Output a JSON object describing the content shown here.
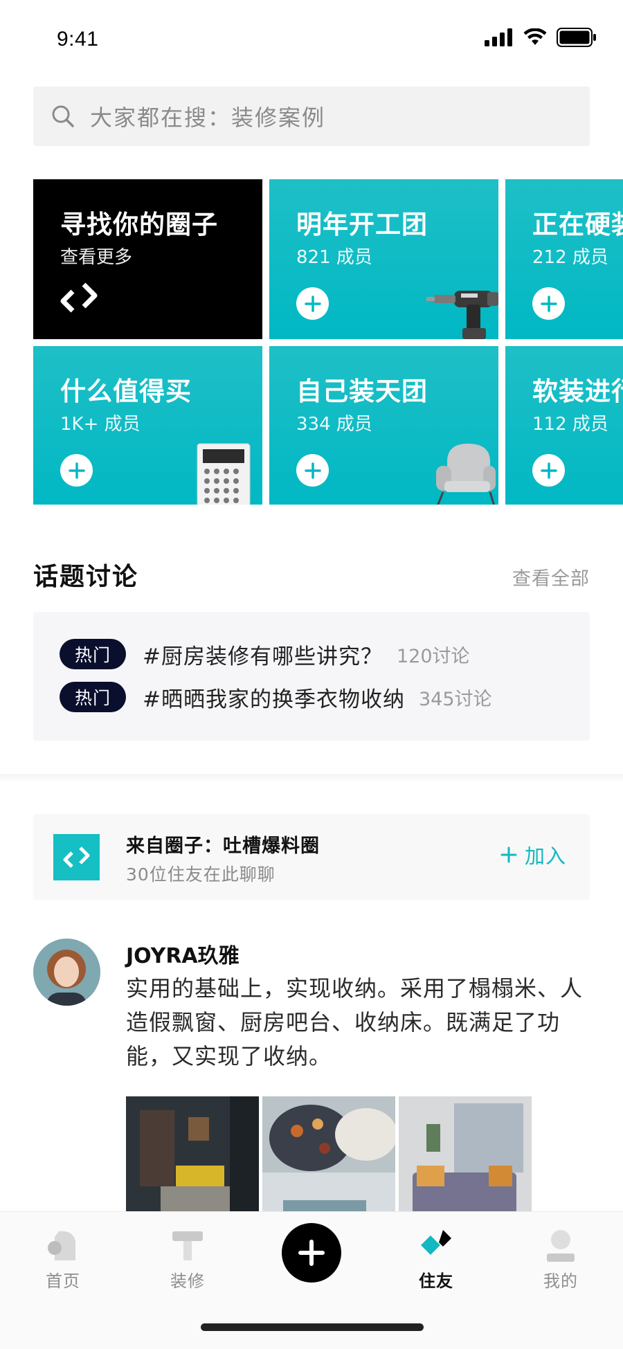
{
  "status_bar": {
    "time": "9:41"
  },
  "search": {
    "placeholder": "大家都在搜：装修案例"
  },
  "circles": {
    "find": {
      "title": "寻找你的圈子",
      "subtitle": "查看更多"
    },
    "items": [
      {
        "title": "明年开工团",
        "members": "821 成员"
      },
      {
        "title": "正在硬装",
        "members": "212 成员"
      },
      {
        "title": "什么值得买",
        "members": "1K+ 成员"
      },
      {
        "title": "自己装天团",
        "members": "334 成员"
      },
      {
        "title": "软装进行",
        "members": "112 成员"
      }
    ]
  },
  "topics": {
    "title": "话题讨论",
    "more": "查看全部",
    "items": [
      {
        "badge": "热门",
        "text": "#厨房装修有哪些讲究？",
        "count": "120讨论"
      },
      {
        "badge": "热门",
        "text": "#晒晒我家的换季衣物收纳",
        "count": "345讨论"
      }
    ]
  },
  "source_circle": {
    "title": "来自圈子：吐槽爆料圈",
    "subtitle": "30位住友在此聊聊",
    "join_label": "加入"
  },
  "post": {
    "author": "JOYRA玖雅",
    "body": "实用的基础上，实现收纳。采用了榻榻米、人造假飘窗、厨房吧台、收纳床。既满足了功能，又实现了收纳。"
  },
  "tab_bar": {
    "items": [
      {
        "label": "首页",
        "icon": "home-icon"
      },
      {
        "label": "装修",
        "icon": "hammer-icon"
      },
      {
        "label": "",
        "icon": "plus-icon"
      },
      {
        "label": "住友",
        "icon": "friends-icon",
        "active": true
      },
      {
        "label": "我的",
        "icon": "profile-icon"
      }
    ]
  },
  "colors": {
    "accent": "#13b8c0",
    "badge": "#0b0f2e"
  }
}
